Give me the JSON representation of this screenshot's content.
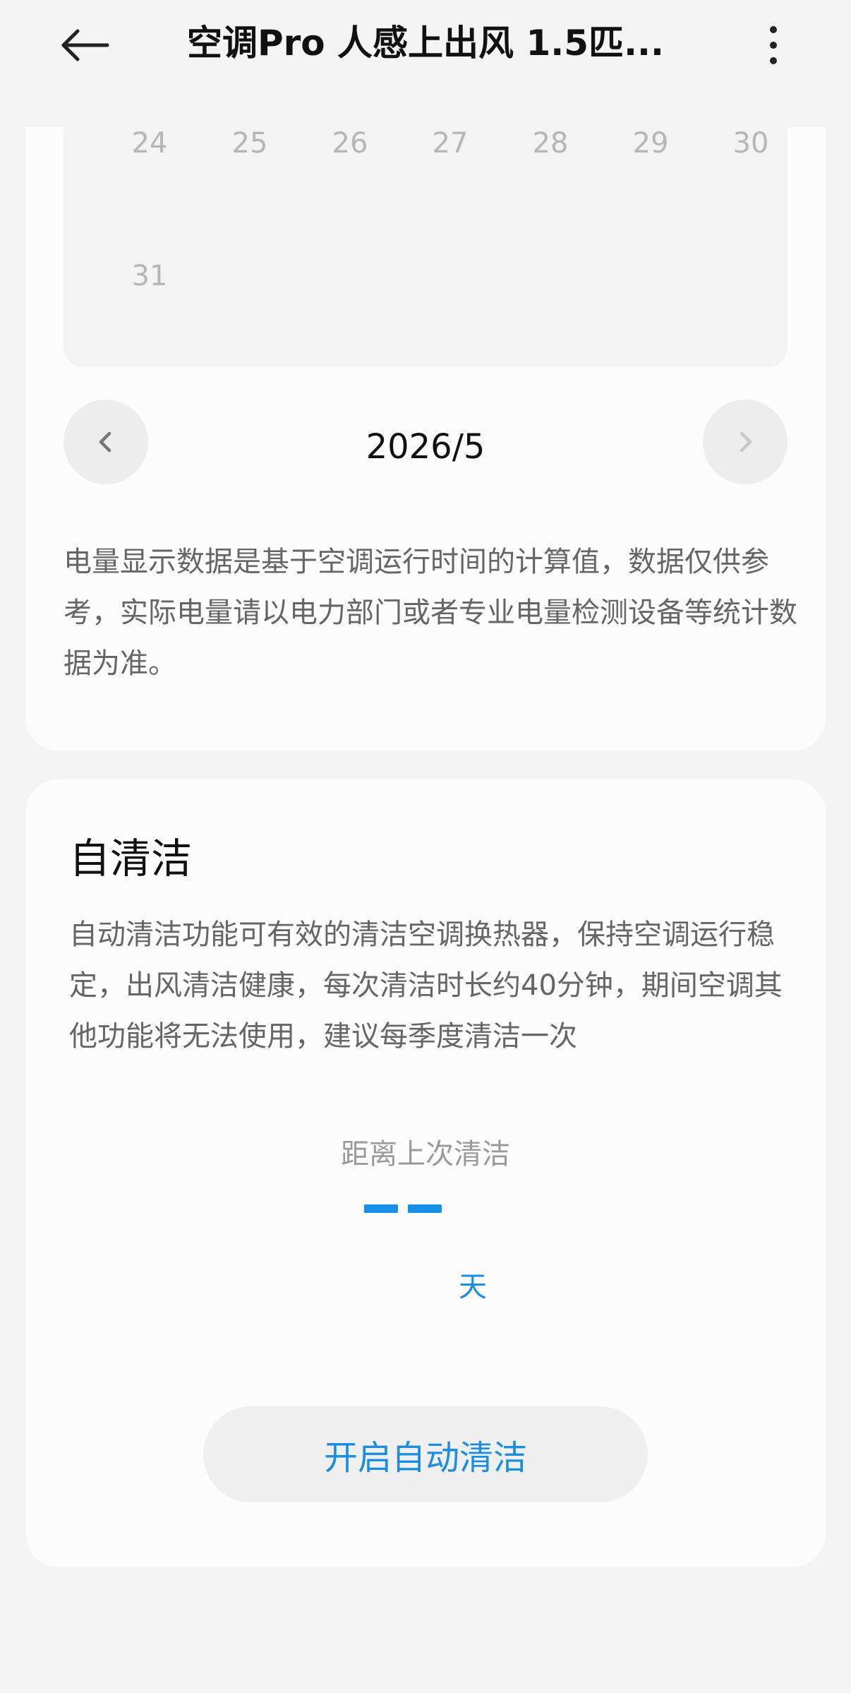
{
  "header": {
    "title": "空调Pro 人感上出风 1.5匹...",
    "back_icon": "arrow-left-icon",
    "more_icon": "more-vertical-icon"
  },
  "calendar": {
    "week_days": [
      "24",
      "25",
      "26",
      "27",
      "28",
      "29",
      "30"
    ],
    "last_row": [
      "31"
    ],
    "month": "2026/5",
    "prev_icon": "chevron-left-icon",
    "next_icon": "chevron-right-icon"
  },
  "energy": {
    "disclaimer": "电量显示数据是基于空调运行时间的计算值，数据仅供参考，实际电量请以电力部门或者专业电量检测设备等统计数据为准。"
  },
  "self_clean": {
    "title": "自清洁",
    "description": "自动清洁功能可有效的清洁空调换热器，保持空调运行稳定，出风清洁健康，每次清洁时长约40分钟，期间空调其他功能将无法使用，建议每季度清洁一次",
    "since_label": "距离上次清洁",
    "days_unit": "天",
    "button_label": "开启自动清洁"
  },
  "colors": {
    "accent": "#1b8ee0",
    "background": "#f4f4f4",
    "card": "#fcfcfc"
  }
}
